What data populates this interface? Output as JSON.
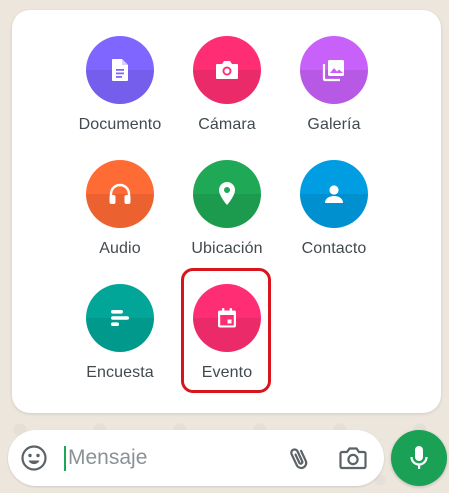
{
  "attachments": [
    {
      "id": "documento",
      "label": "Documento",
      "icon": "document-icon",
      "color": "#7f66ff"
    },
    {
      "id": "camara",
      "label": "Cámara",
      "icon": "camera-icon",
      "color": "#ff2e74"
    },
    {
      "id": "galeria",
      "label": "Galería",
      "icon": "gallery-icon",
      "color": "#c861fa"
    },
    {
      "id": "audio",
      "label": "Audio",
      "icon": "headphones-icon",
      "color": "#ff6b35"
    },
    {
      "id": "ubicacion",
      "label": "Ubicación",
      "icon": "location-pin-icon",
      "color": "#1fa855"
    },
    {
      "id": "contacto",
      "label": "Contacto",
      "icon": "contact-person-icon",
      "color": "#009de2"
    },
    {
      "id": "encuesta",
      "label": "Encuesta",
      "icon": "poll-icon",
      "color": "#02a698"
    },
    {
      "id": "evento",
      "label": "Evento",
      "icon": "calendar-icon",
      "color": "#ff2e74"
    }
  ],
  "highlighted": "evento",
  "highlight_color": "#d8141d",
  "composer": {
    "placeholder": "Mensaje",
    "emoji_icon": "emoji-icon",
    "attach_icon": "paperclip-icon",
    "camera_icon": "camera-icon",
    "send_icon": "microphone-icon",
    "accent": "#1aa156"
  }
}
